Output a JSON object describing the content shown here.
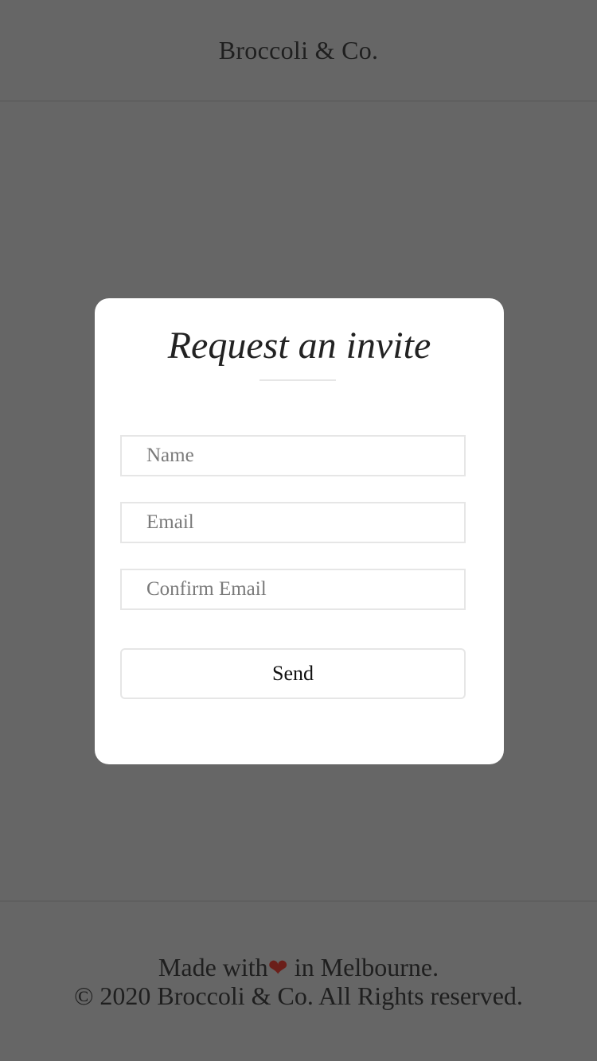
{
  "header": {
    "brand": "Broccoli & Co."
  },
  "modal": {
    "title": "Request an invite",
    "fields": {
      "name_placeholder": "Name",
      "email_placeholder": "Email",
      "confirm_email_placeholder": "Confirm Email"
    },
    "send_label": "Send"
  },
  "footer": {
    "made_with_prefix": "Made with",
    "heart_icon": "heart-icon",
    "heart_glyph": "❤",
    "made_with_suffix": " in Melbourne.",
    "copyright": "© 2020 Broccoli & Co. All Rights reserved."
  },
  "colors": {
    "overlay_background": "#666666",
    "modal_background": "#ffffff",
    "heart": "#6b1f1a"
  }
}
